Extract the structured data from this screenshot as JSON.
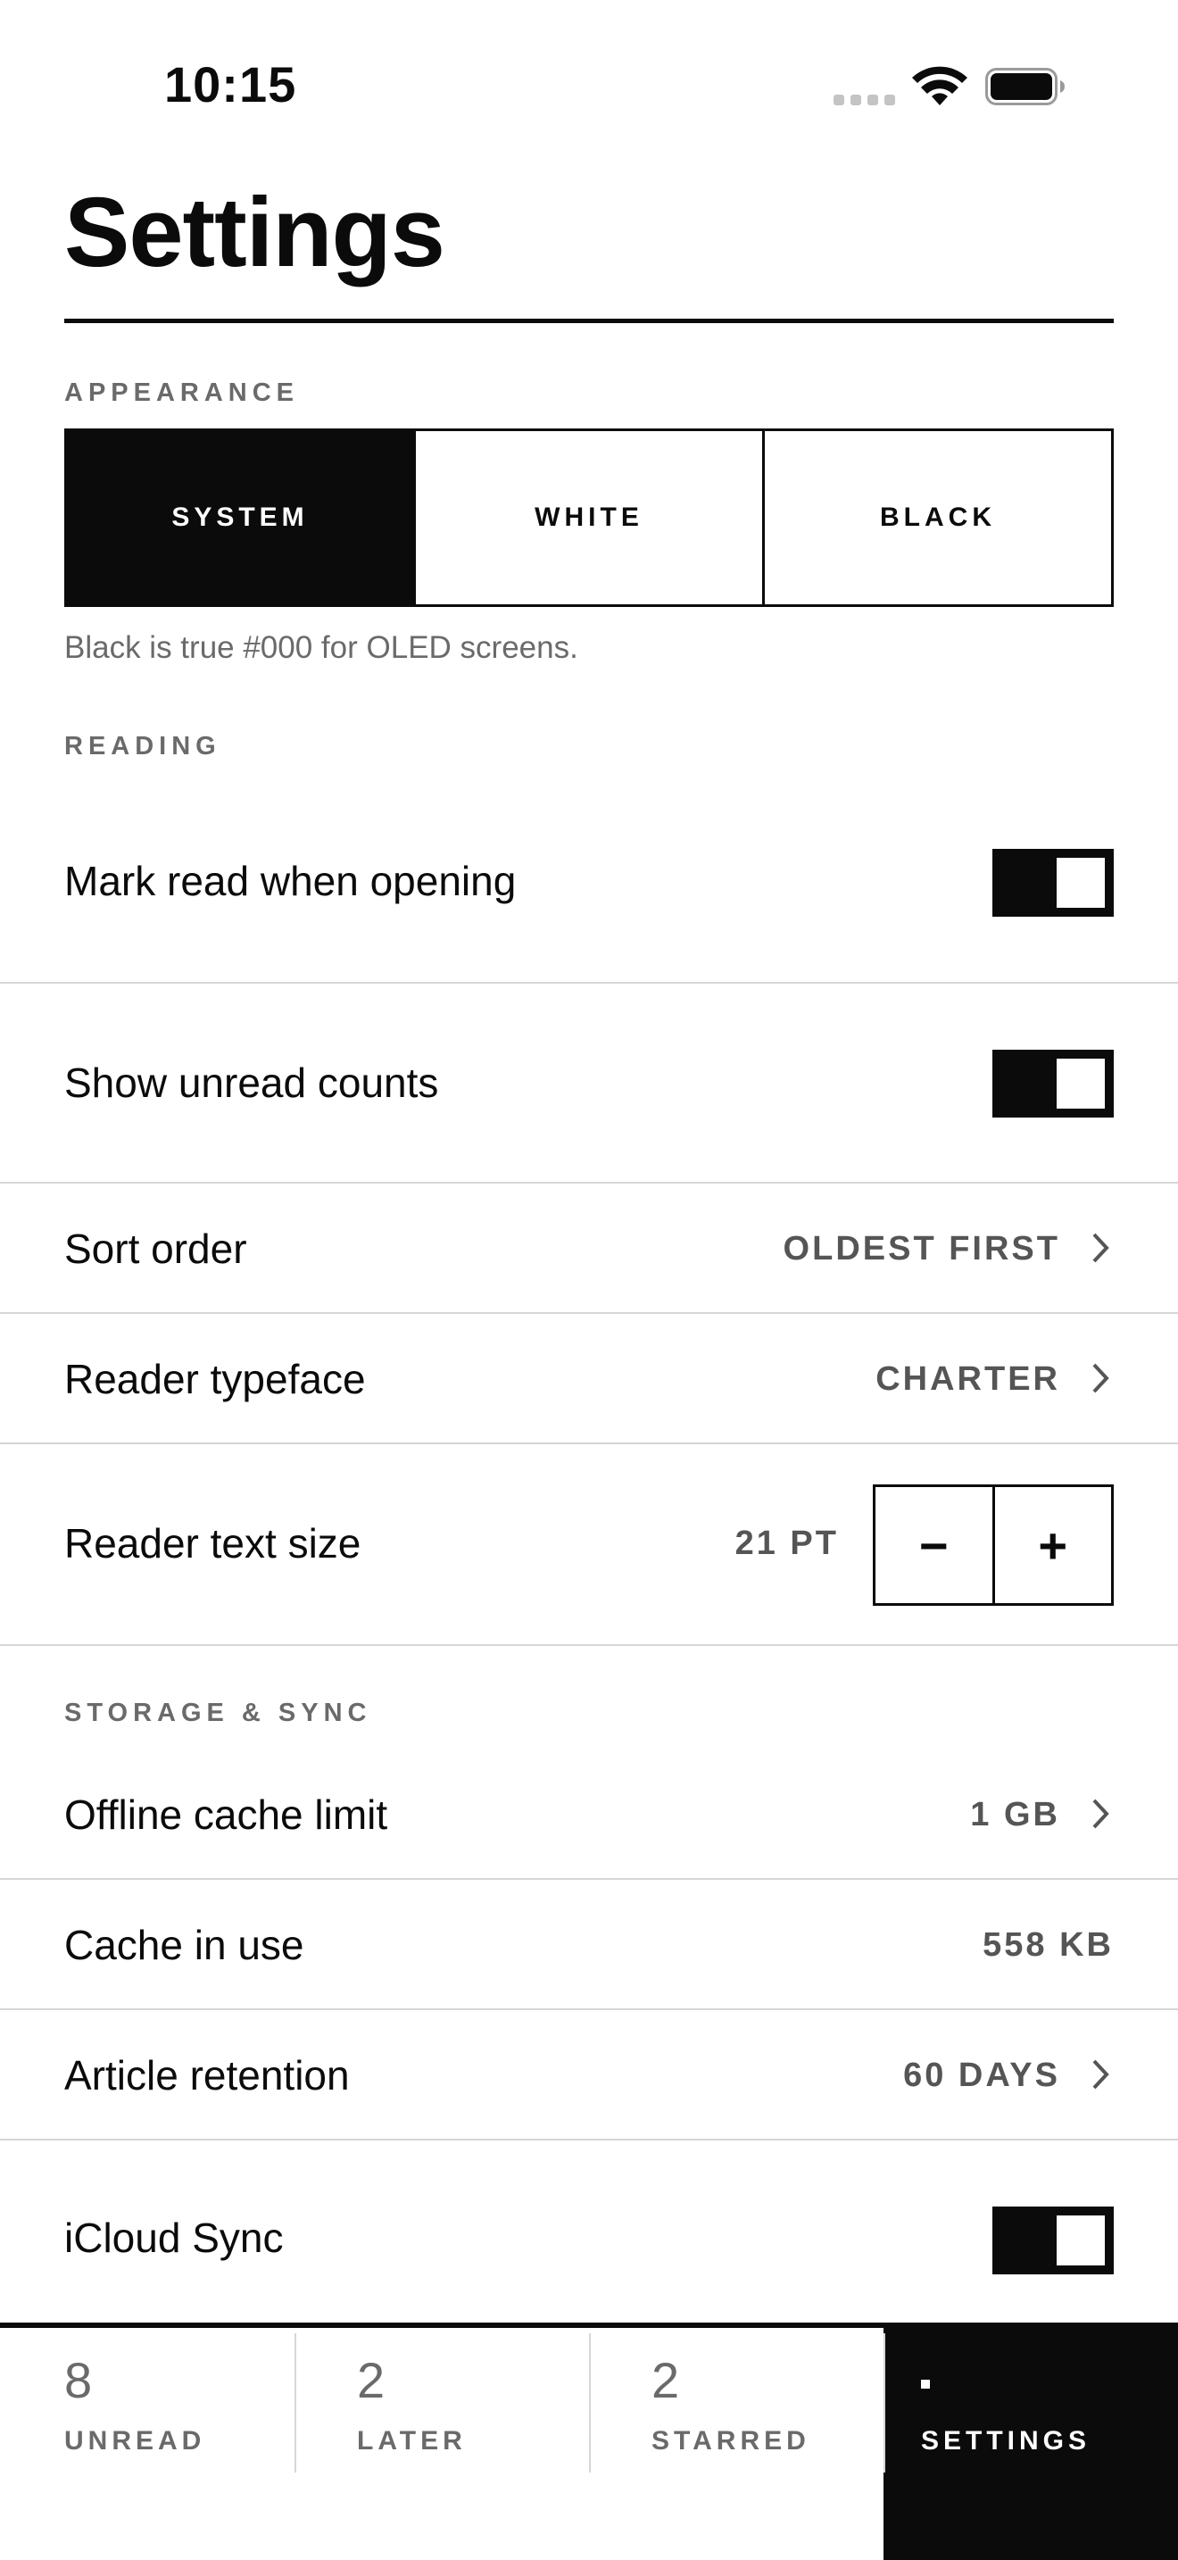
{
  "status_bar": {
    "time": "10:15"
  },
  "header": {
    "title": "Settings"
  },
  "appearance": {
    "label": "APPEARANCE",
    "options": [
      "SYSTEM",
      "WHITE",
      "BLACK"
    ],
    "selected": "SYSTEM",
    "hint": "Black is true #000 for OLED screens."
  },
  "reading": {
    "label": "READING",
    "mark_read": {
      "label": "Mark read when opening",
      "on": true
    },
    "unread_counts": {
      "label": "Show unread counts",
      "on": true
    },
    "sort_order": {
      "label": "Sort order",
      "value": "OLDEST FIRST"
    },
    "typeface": {
      "label": "Reader typeface",
      "value": "CHARTER"
    },
    "text_size": {
      "label": "Reader text size",
      "value": "21 PT",
      "decrement": "−",
      "increment": "+"
    }
  },
  "storage": {
    "label": "STORAGE & SYNC",
    "cache_limit": {
      "label": "Offline cache limit",
      "value": "1 GB"
    },
    "cache_in_use": {
      "label": "Cache in use",
      "value": "558 KB"
    },
    "retention": {
      "label": "Article retention",
      "value": "60 DAYS"
    },
    "icloud": {
      "label": "iCloud Sync",
      "on": true
    }
  },
  "tabs": [
    {
      "count": "8",
      "label": "UNREAD"
    },
    {
      "count": "2",
      "label": "LATER"
    },
    {
      "count": "2",
      "label": "STARRED"
    },
    {
      "count": "",
      "label": "SETTINGS",
      "active": true
    }
  ]
}
